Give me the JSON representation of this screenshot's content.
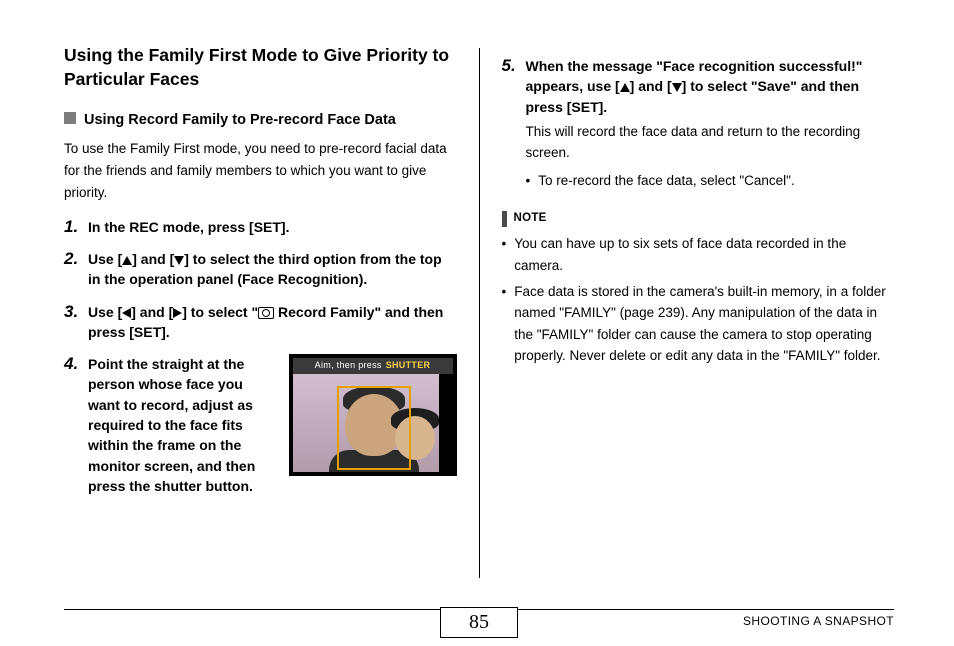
{
  "title": "Using the Family First Mode to Give Priority to Particular Faces",
  "subhead": "Using Record Family to Pre-record Face Data",
  "intro": "To use the Family First mode, you need to pre-record facial data for the friends and family members to which you want to give priority.",
  "steps": {
    "s1": "In the REC mode, press [SET].",
    "s2a": "Use [",
    "s2b": "] and [",
    "s2c": "] to select the third option from the top in the operation panel (Face Recognition).",
    "s3a": "Use [",
    "s3b": "] and [",
    "s3c": "] to select \"",
    "s3d": " Record Family\" and then press [SET].",
    "s4": "Point the straight at the person whose face you want to record, adjust as required to the face fits within the frame on the monitor screen, and then press the shutter button.",
    "s5a": "When the message \"Face recognition successful!\" appears, use [",
    "s5b": "] and [",
    "s5c": "] to select \"Save\" and then press [SET].",
    "s5sub": "This will record the face data and return to the recording screen.",
    "s5bul": "To re-record the face data, select \"Cancel\"."
  },
  "thumb": {
    "bar_a": "Aim, then press",
    "bar_b": "SHUTTER"
  },
  "note": {
    "label": "NOTE",
    "n1": "You can have up to six sets of face data recorded in the camera.",
    "n2": "Face data is stored in the camera's built-in memory, in a folder named \"FAMILY\" (page 239). Any manipulation of the data in the \"FAMILY\" folder can cause the camera to stop operating properly. Never delete or edit any data in the \"FAMILY\" folder."
  },
  "footer": {
    "page": "85",
    "section": "SHOOTING A SNAPSHOT"
  }
}
